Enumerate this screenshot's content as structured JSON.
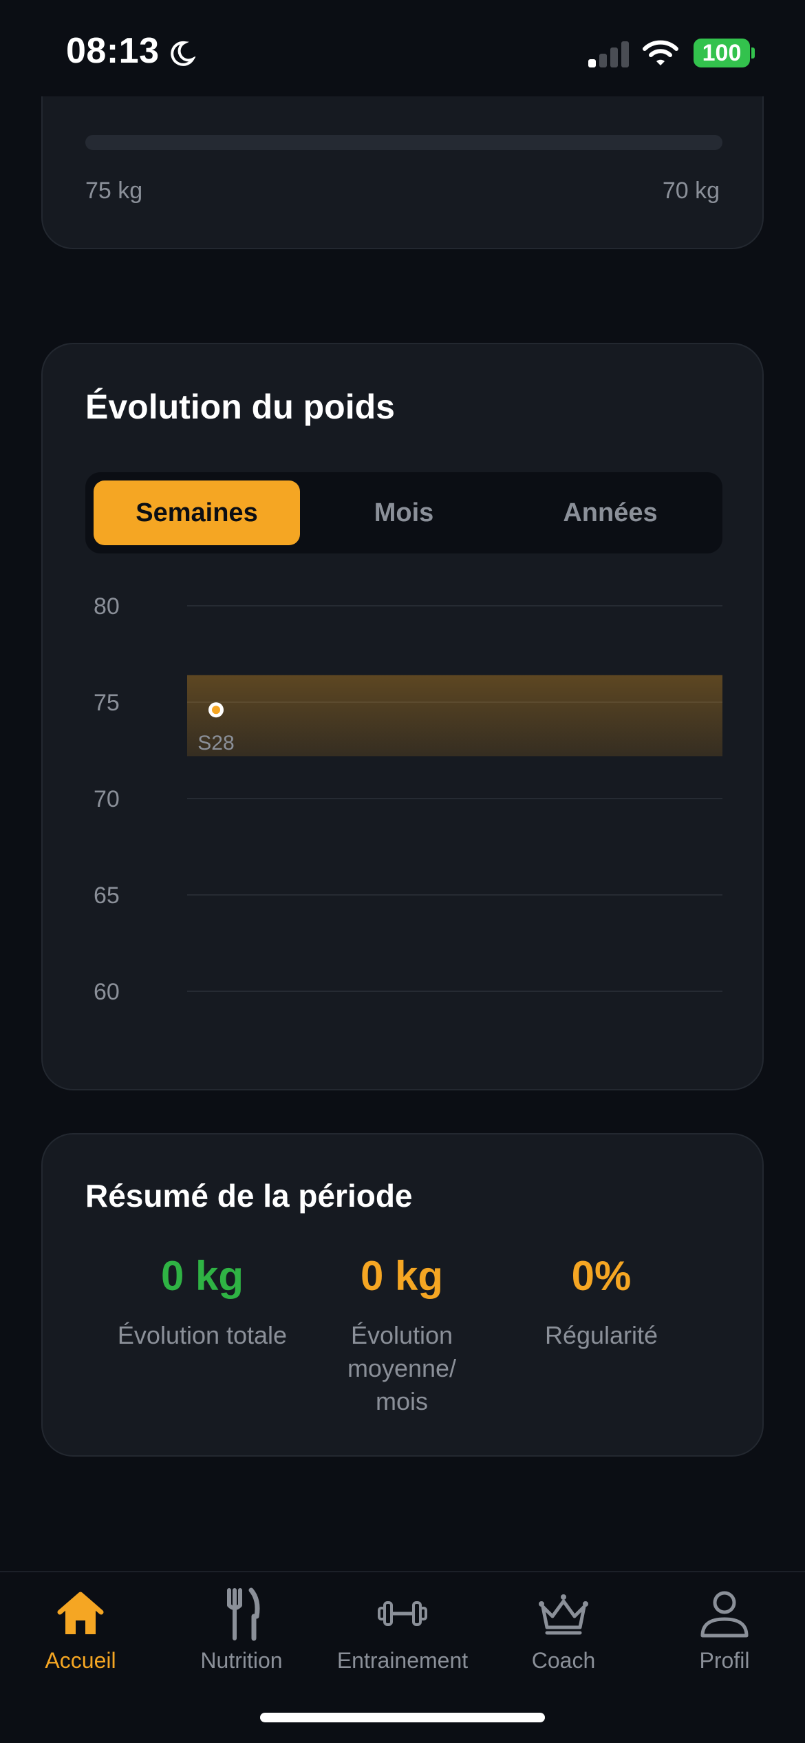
{
  "status_bar": {
    "time": "08:13",
    "battery": "100"
  },
  "goal": {
    "start_label": "75 kg",
    "end_label": "70 kg",
    "progress": 0
  },
  "weight_card": {
    "title": "Évolution du poids",
    "segments": [
      "Semaines",
      "Mois",
      "Années"
    ],
    "active_segment": "Semaines"
  },
  "chart_data": {
    "type": "line",
    "x": [
      "S28"
    ],
    "series": [
      {
        "values": [
          74.6
        ]
      }
    ],
    "y_ticks": [
      80,
      75,
      70,
      65,
      60
    ],
    "ylim": [
      60,
      80
    ],
    "band": [
      72.2,
      76.4
    ],
    "grid": true,
    "colors": {
      "point": "#f5a623",
      "band": "#f5a623",
      "grid": "#262b33"
    }
  },
  "summary": {
    "title": "Résumé de la période",
    "stats": [
      {
        "value": "0 kg",
        "label": "Évolution totale",
        "color": "#2fb344"
      },
      {
        "value": "0 kg",
        "label": "Évolution moyenne/ mois",
        "color": "#f5a623"
      },
      {
        "value": "0%",
        "label": "Régularité",
        "color": "#f5a623"
      }
    ]
  },
  "tab_bar": {
    "items": [
      {
        "label": "Accueil",
        "icon": "home-icon",
        "active": true
      },
      {
        "label": "Nutrition",
        "icon": "fork-knife-icon",
        "active": false
      },
      {
        "label": "Entrainement",
        "icon": "dumbbell-icon",
        "active": false
      },
      {
        "label": "Coach",
        "icon": "crown-icon",
        "active": false
      },
      {
        "label": "Profil",
        "icon": "person-icon",
        "active": false
      }
    ]
  },
  "colors": {
    "accent": "#f5a623",
    "background": "#0b0e14",
    "card": "#161a21",
    "muted": "#8b9099"
  }
}
